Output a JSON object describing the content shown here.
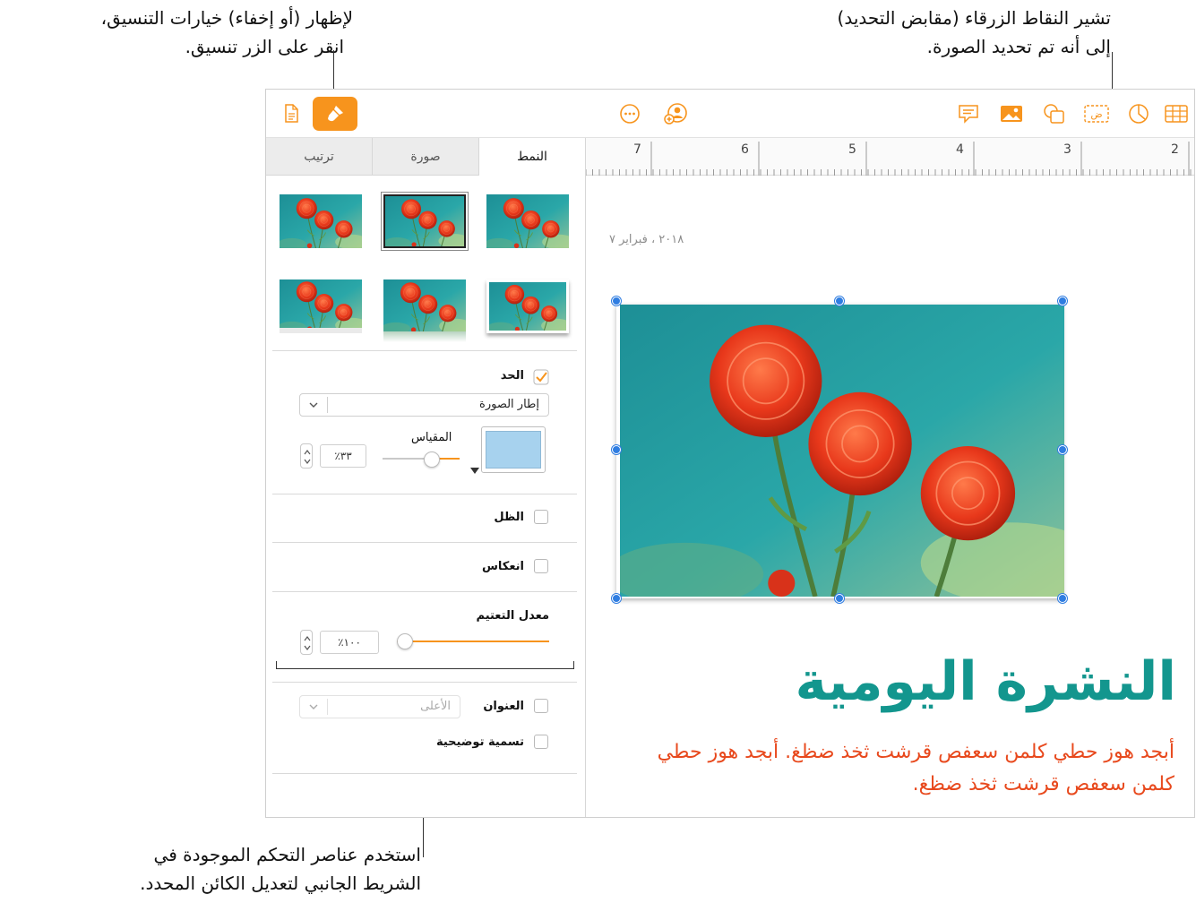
{
  "callouts": {
    "format_hint": {
      "line1": "لإظهار (أو إخفاء) خيارات التنسيق،",
      "line2": "انقر على الزر تنسيق."
    },
    "handles_hint": {
      "line1": "تشير النقاط الزرقاء (مقابض التحديد)",
      "line2": "إلى أنه تم تحديد الصورة."
    },
    "sidebar_hint": {
      "line1": "استخدم عناصر التحكم الموجودة في",
      "line2": "الشريط الجانبي لتعديل الكائن المحدد."
    }
  },
  "toolbar": {
    "left_icons": [
      "document-icon",
      "format-brush-icon"
    ],
    "center_icons": [
      "more-icon",
      "collaborate-icon"
    ],
    "right_icons": [
      "comment-icon",
      "media-icon",
      "shape-icon",
      "text-icon",
      "chart-icon",
      "table-icon"
    ],
    "text_icon_glyph": "ض",
    "accent_color": "#f7941d"
  },
  "sidebar": {
    "tabs": [
      {
        "label": "ترتيب",
        "active": false
      },
      {
        "label": "صورة",
        "active": false
      },
      {
        "label": "النمط",
        "active": true
      }
    ],
    "border": {
      "label": "الحد",
      "checked": true,
      "style_value": "إطار الصورة",
      "scale_label": "المقياس",
      "scale_value": "٪٣٣",
      "scale_level": 0.33
    },
    "shadow": {
      "label": "الظل",
      "checked": false
    },
    "reflection": {
      "label": "انعكاس",
      "checked": false
    },
    "opacity": {
      "label": "معدل التعتيم",
      "value": "٪١٠٠",
      "level": 1.0
    },
    "title": {
      "label": "العنوان",
      "checked": false,
      "position_value": "الأعلى"
    },
    "caption": {
      "label": "تسمية توضيحية",
      "checked": false
    }
  },
  "canvas": {
    "ruler_numbers": [
      "7",
      "6",
      "5",
      "4",
      "3",
      "2"
    ],
    "date_text": "٢٠١٨ ، فبراير ٧",
    "headline": "النشرة اليومية",
    "body_text": "أبجد هوز حطي كلمن سعفص قرشت ثخذ ضظغ. أبجد هوز حطي كلمن سعفص قرشت ثخذ ضظغ.",
    "headline_color": "#13968e",
    "body_color": "#e8491d",
    "selection_color": "#2f7de1"
  }
}
